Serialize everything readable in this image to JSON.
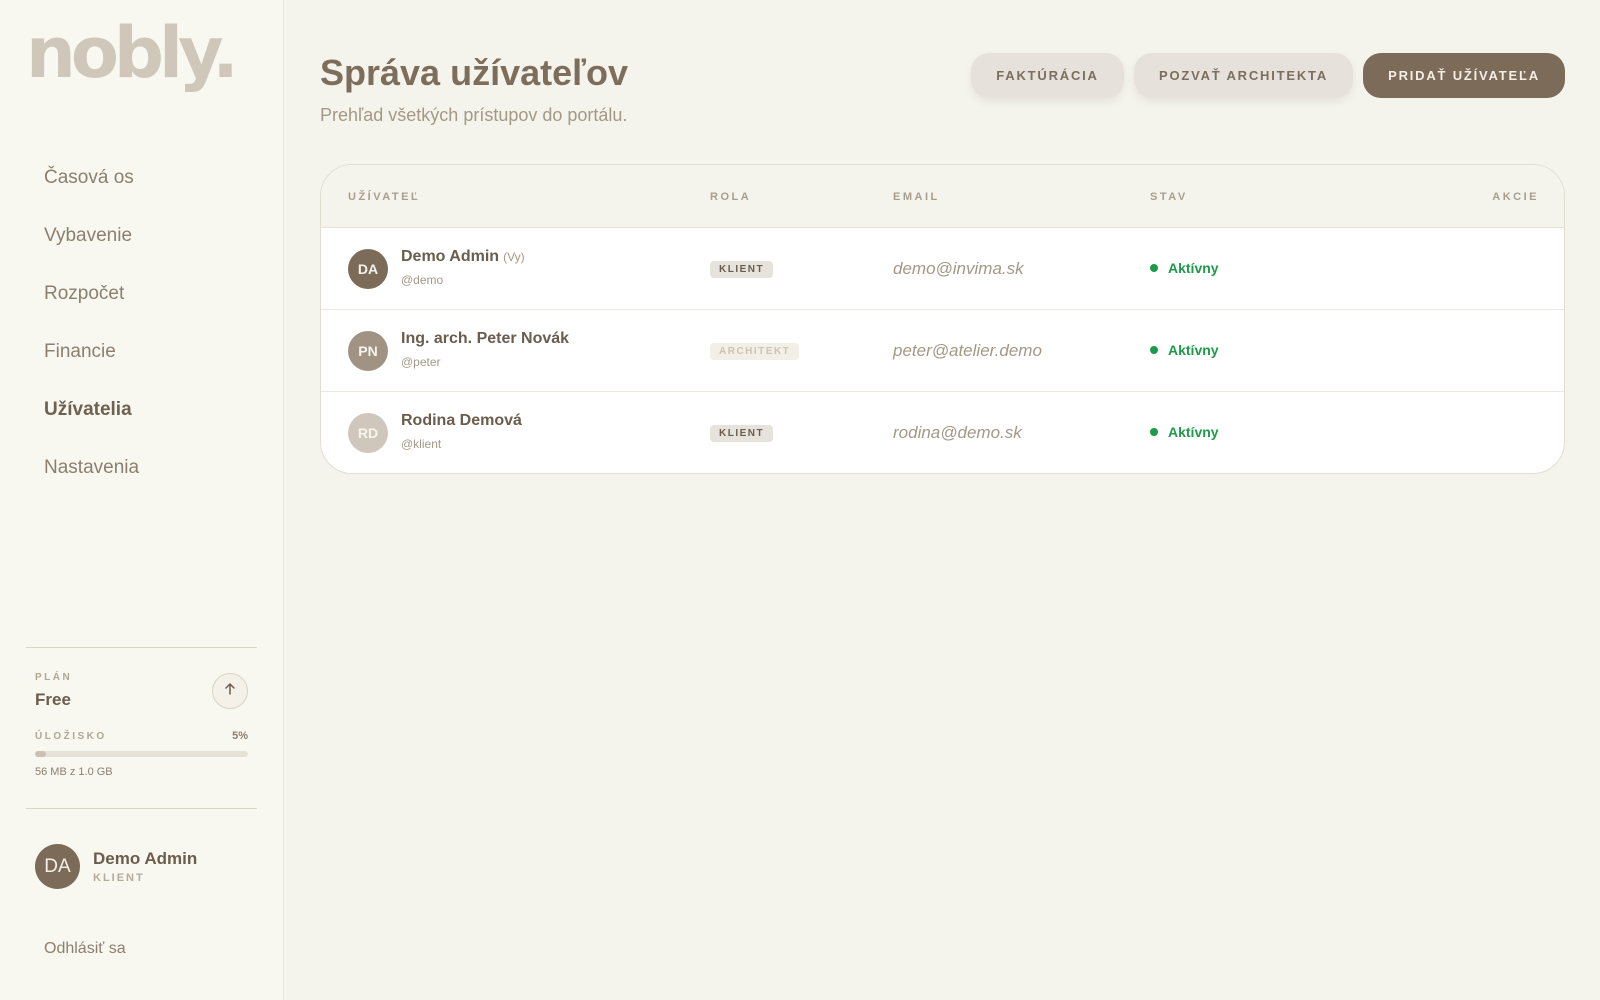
{
  "sidebar": {
    "logo": "nobly.",
    "nav": [
      {
        "label": "Časová os",
        "active": false
      },
      {
        "label": "Vybavenie",
        "active": false
      },
      {
        "label": "Rozpočet",
        "active": false
      },
      {
        "label": "Financie",
        "active": false
      },
      {
        "label": "Užívatelia",
        "active": true
      },
      {
        "label": "Nastavenia",
        "active": false
      }
    ],
    "plan": {
      "label": "PLÁN",
      "value": "Free",
      "upgrade_icon": "arrow-up-icon"
    },
    "storage": {
      "label": "ÚLOŽISKO",
      "percent_label": "5%",
      "percent": 5,
      "used_text": "56 MB z 1.0 GB"
    },
    "user": {
      "initials": "DA",
      "name": "Demo Admin",
      "role": "KLIENT"
    },
    "logout": "Odhlásiť sa"
  },
  "header": {
    "title": "Správa užívateľov",
    "subtitle": "Prehľad všetkých prístupov do portálu.",
    "buttons": {
      "billing": "FAKTÚRÁCIA",
      "invite_architect": "POZVAŤ ARCHITEKTA",
      "add_user": "PRIDAŤ UŽÍVATEĽA"
    }
  },
  "table": {
    "columns": {
      "user": "UŽÍVATEĽ",
      "role": "ROLA",
      "email": "EMAIL",
      "status": "STAV",
      "actions": "AKCIE"
    },
    "rows": [
      {
        "initials": "DA",
        "avatar_color": "#7b6b58",
        "name": "Demo Admin",
        "you": "(Vy)",
        "handle": "@demo",
        "role": "KLIENT",
        "role_type": "klient",
        "email": "demo@invima.sk",
        "status": "Aktívny"
      },
      {
        "initials": "PN",
        "avatar_color": "#a09383",
        "name": "Ing. arch. Peter Novák",
        "you": "",
        "handle": "@peter",
        "role": "ARCHITEKT",
        "role_type": "architekt",
        "email": "peter@atelier.demo",
        "status": "Aktívny"
      },
      {
        "initials": "RD",
        "avatar_color": "#cfc7bb",
        "name": "Rodina Demová",
        "you": "",
        "handle": "@klient",
        "role": "KLIENT",
        "role_type": "klient",
        "email": "rodina@demo.sk",
        "status": "Aktívny"
      }
    ]
  },
  "colors": {
    "accent": "#7b6b58",
    "status_active": "#1f9a4a",
    "background": "#f5f4ec"
  }
}
